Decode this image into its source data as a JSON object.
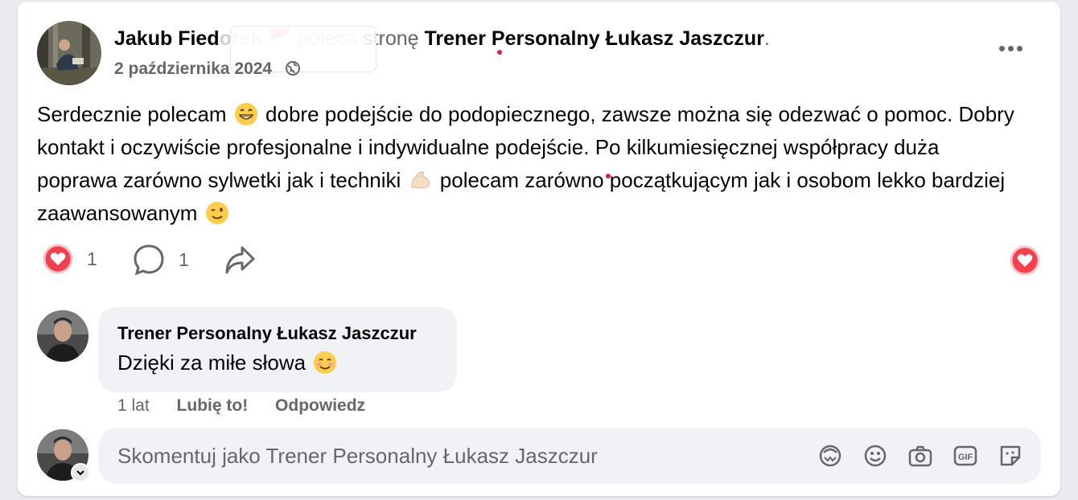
{
  "post": {
    "author": "Jakub Fied",
    "hidden_author_suffix": "orek",
    "recommend_emoji": "🚩",
    "recommend_text": "poleca",
    "action_text": "stronę",
    "page_name": "Trener Personalny Łukasz Jaszczur",
    "period": ".",
    "date": "2 października 2024",
    "audience_icon": "globe-icon",
    "body_parts": {
      "p1": "Serdecznie polecam",
      "p2": "dobre podejście do podopiecznego, zawsze można się odezwać o pomoc. Dobry kontakt i oczywiście profesjonalne i indywidualne podejście. Po kilkumiesięcznej współpracy duża poprawa zarówno sylwetki jak i techniki",
      "p3": "polecam zarówno początkującym jak i osobom lekko bardziej zaawansowanym"
    },
    "emojis": [
      "grinning-face",
      "flexed-biceps",
      "winking-face"
    ],
    "reactions_count": "1",
    "comments_count": "1"
  },
  "comment": {
    "author": "Trener Personalny Łukasz Jaszczur",
    "text": "Dzięki za miłe słowa",
    "emoji": "smiling-face",
    "age": "1 lat",
    "like_label": "Lubię to!",
    "reply_label": "Odpowiedz"
  },
  "composer": {
    "placeholder": "Skomentuj jako Trener Personalny Łukasz Jaszczur",
    "icons": [
      "avatar-sticker-icon",
      "emoji-icon",
      "camera-icon",
      "gif-icon",
      "sticker-icon"
    ]
  },
  "colors": {
    "heart": "#e8435a",
    "muted_text": "#65676b",
    "bubble": "#f0f2f5"
  }
}
